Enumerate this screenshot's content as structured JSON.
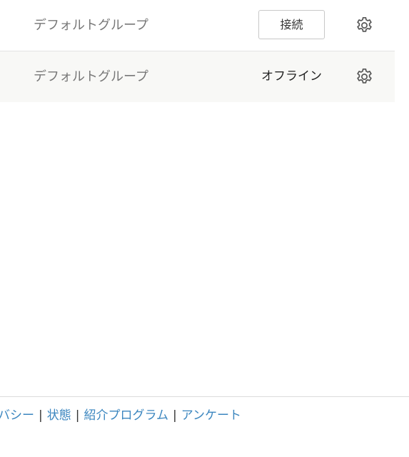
{
  "rows": [
    {
      "group": "デフォルトグループ",
      "action_label": "接続",
      "settings_icon": "gear-icon"
    },
    {
      "group": "デフォルトグループ",
      "status": "オフライン",
      "settings_icon": "gear-icon"
    }
  ],
  "footer": {
    "links": [
      "バシー",
      "状態",
      "紹介プログラム",
      "アンケート"
    ],
    "separator": "|"
  },
  "colors": {
    "link": "#3b86bf",
    "row_alt_background": "#f8f8f6",
    "muted_text": "#777777"
  }
}
